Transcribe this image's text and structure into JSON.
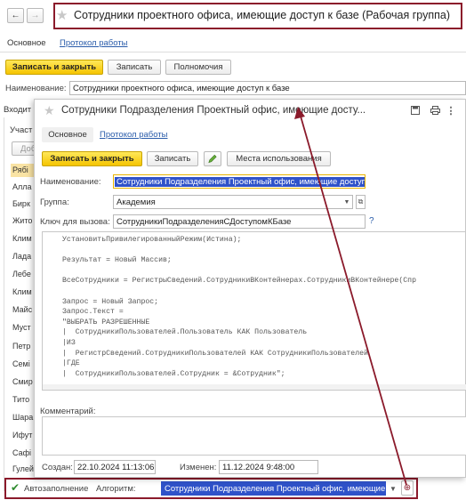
{
  "main": {
    "title": "Сотрудники проектного офиса, имеющие доступ к базе (Рабочая группа)",
    "tab_main": "Основное",
    "tab_log": "Протокол работы",
    "save_close": "Записать и закрыть",
    "save": "Записать",
    "permissions": "Полномочия",
    "name_label": "Наименование:",
    "name_value": "Сотрудники проектного офиса, имеющие доступ к базе",
    "tab_included": "Входит",
    "tab_participants": "Участ",
    "add_btn": "Доб",
    "side_items": [
      "Рябі",
      "Алла",
      "Бирк",
      "Жито",
      "Клим",
      "Лада",
      "Лебе",
      "Клим",
      "Майс",
      "Муст",
      "Петр",
      "Семі",
      "Смир",
      "Тито",
      "Шара",
      "Ифут",
      "Сафі",
      "Гулей"
    ],
    "autofill": "Автозаполнение",
    "algorithm_label": "Алгоритм:",
    "algorithm_value": "Сотрудники Подразделения Проектный офис, имеющие д"
  },
  "dialog": {
    "title": "Сотрудники Подразделения Проектный офис, имеющие досту...",
    "tab_main": "Основное",
    "tab_log": "Протокол работы",
    "save_close": "Записать и закрыть",
    "save": "Записать",
    "usage": "Места использования",
    "name_label": "Наименование:",
    "name_value": "Сотрудники Подразделения Проектный офис, имеющие доступ",
    "group_label": "Группа:",
    "group_value": "Академия",
    "key_label": "Ключ для вызова:",
    "key_value": "СотрудникиПодразделенияСДоступомКБазе",
    "help": "?",
    "code": "УстановитьПривилегированныйРежим(Истина);\n\nРезультат = Новый Массив;\n\nВсеСотрудники = РегистрыСведений.СотрудникиВКонтейнерах.СотрудникиВКонтейнере(Спр\n\nЗапрос = Новый Запрос;\nЗапрос.Текст =\n\"ВЫБРАТЬ РАЗРЕШЕННЫЕ\n|  СотрудникиПользователей.Пользователь КАК Пользователь\n|ИЗ\n|  РегистрСведений.СотрудникиПользователей КАК СотрудникиПользователей\n|ГДЕ\n|  СотрудникиПользователей.Сотрудник = &Сотрудник\";\n\nДля Каждого Участник Из ВсеСотрудники Цикл\n  Запрос.УстановитьПараметр(\"Сотрудник\", участник);",
    "comment_label": "Комментарий:",
    "created_label": "Создан:",
    "created_value": "22.10.2024 11:13:06",
    "changed_label": "Изменен:",
    "changed_value": "11.12.2024  9:48:00"
  },
  "colors": {
    "annotation": "#8b1a2b",
    "selection": "#2f52c9",
    "yellow": "#f5c400",
    "link": "#2a5caa"
  }
}
